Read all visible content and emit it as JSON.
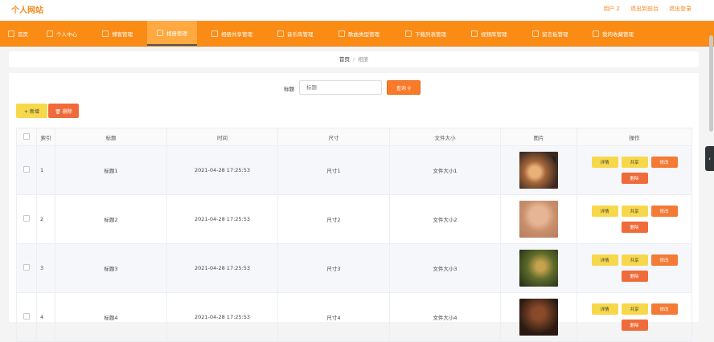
{
  "header": {
    "site_title": "个人网站",
    "links": [
      "用户 2",
      "退出到前台",
      "退出登录"
    ]
  },
  "nav": [
    {
      "label": "首页"
    },
    {
      "label": "个人中心"
    },
    {
      "label": "博客管理"
    },
    {
      "label": "相册管理"
    },
    {
      "label": "相册共享管理"
    },
    {
      "label": "音乐库管理"
    },
    {
      "label": "歌曲类型管理"
    },
    {
      "label": "下载列表管理"
    },
    {
      "label": "视频库管理"
    },
    {
      "label": "留言板管理"
    },
    {
      "label": "我的收藏管理"
    }
  ],
  "breadcrumb": {
    "home": "首页",
    "sep": "/",
    "current": "相册"
  },
  "search": {
    "label": "标题",
    "placeholder": "标题",
    "button": "查询 ⚲"
  },
  "actions": {
    "add": "+ 新增",
    "delete": "🗑 删除"
  },
  "table": {
    "headers": [
      "",
      "索引",
      "标题",
      "时间",
      "尺寸",
      "文件大小",
      "图片",
      "操作"
    ],
    "rows": [
      {
        "index": "1",
        "title": "标题1",
        "time": "2021-04-28 17:25:53",
        "size": "尺寸1",
        "file_size": "文件大小1"
      },
      {
        "index": "2",
        "title": "标题2",
        "time": "2021-04-28 17:25:53",
        "size": "尺寸2",
        "file_size": "文件大小2"
      },
      {
        "index": "3",
        "title": "标题3",
        "time": "2021-04-28 17:25:53",
        "size": "尺寸3",
        "file_size": "文件大小3"
      },
      {
        "index": "4",
        "title": "标题4",
        "time": "2021-04-28 17:25:53",
        "size": "尺寸4",
        "file_size": "文件大小4"
      }
    ],
    "row_buttons": {
      "detail": "详情",
      "share": "共享",
      "edit": "修改",
      "delete": "删除"
    }
  },
  "colors": {
    "accent": "#fa8c16",
    "nav_active": "#ffa940",
    "edit_button": "#f47a35",
    "detail_button": "#f7d84a"
  }
}
